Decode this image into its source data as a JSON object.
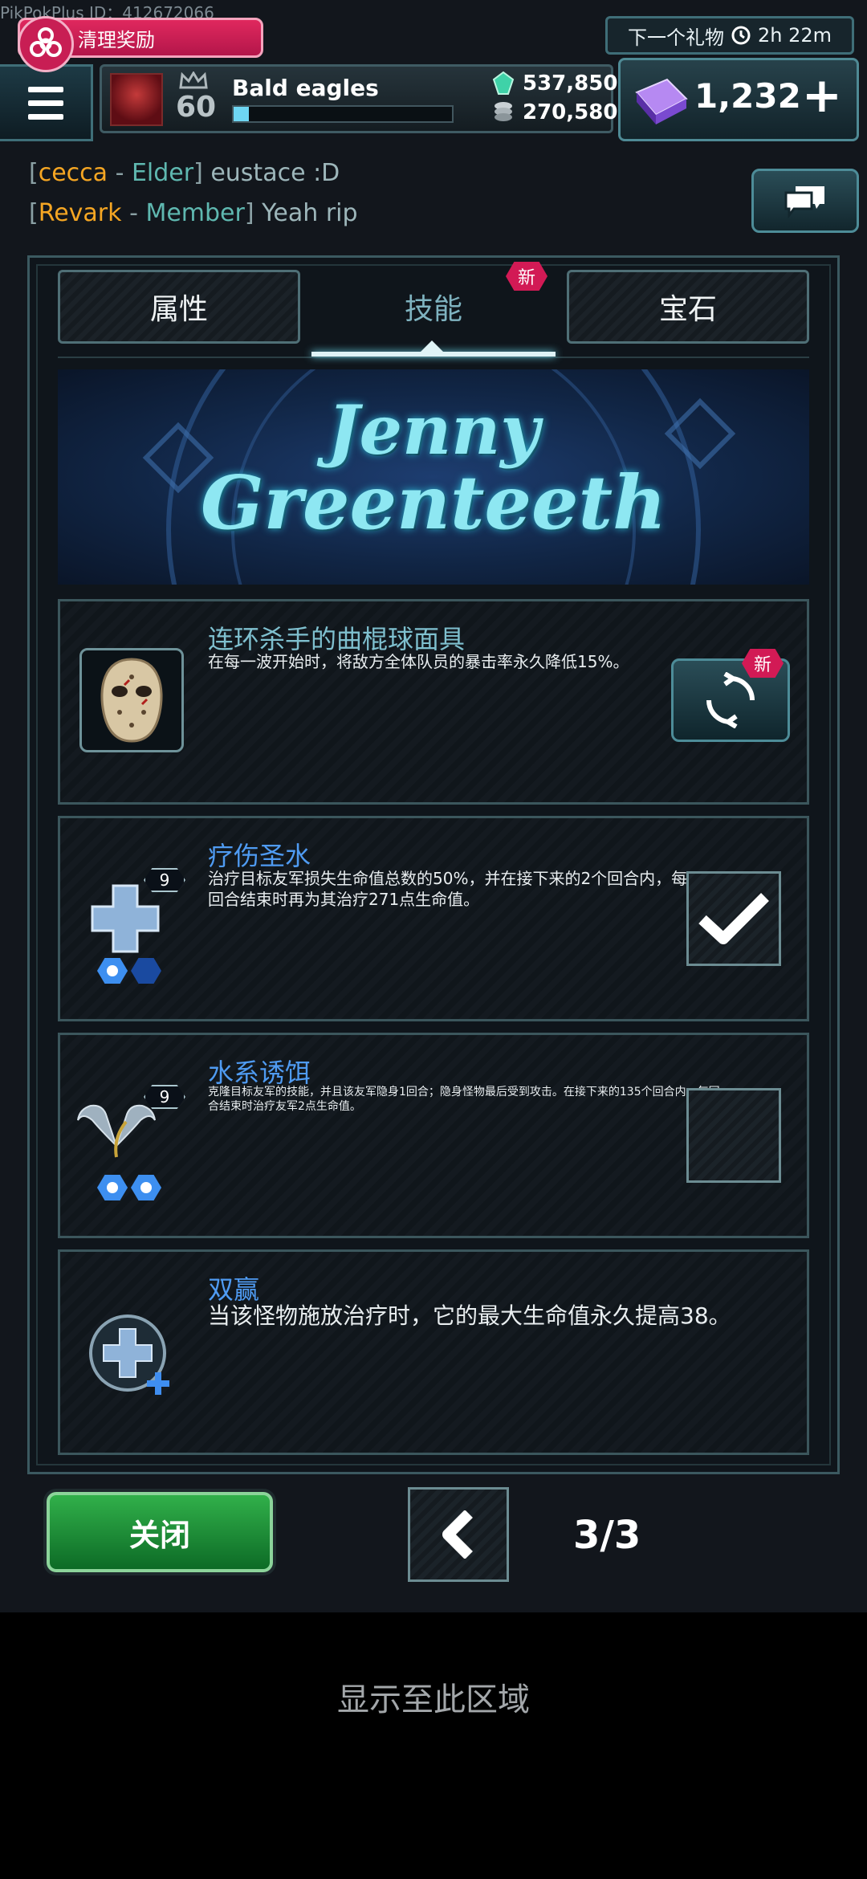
{
  "top": {
    "pid_label": "PikPokPlus ID：412672066",
    "reward_banner": "清理奖励",
    "player": {
      "level": "60",
      "name": "Bald eagles",
      "xp_progress": 0.07
    },
    "resources": {
      "gems": "537,850",
      "coins": "270,580"
    },
    "gift_timer": {
      "label": "下一个礼物",
      "time": "2h 22m"
    },
    "premium": {
      "amount": "1,232",
      "plus": "+"
    }
  },
  "chat": [
    {
      "name": "cecca",
      "role": "Elder",
      "message": "eustace  :D"
    },
    {
      "name": "Revark",
      "role": "Member",
      "message": "Yeah rip"
    }
  ],
  "tabs": {
    "attributes": "属性",
    "skills": "技能",
    "gems": "宝石",
    "new_badge": "新"
  },
  "banner": {
    "line1": "Jenny",
    "line2": "Greenteeth"
  },
  "skills": [
    {
      "title": "连环杀手的曲棍球面具",
      "description": "在每一波开始时，将敌方全体队员的暴击率永久降低15%。",
      "new_badge": "新",
      "title_color": "#7fc0cf"
    },
    {
      "title": "疗伤圣水",
      "description": "治疗目标友军损失生命值总数的50%，并在接下来的2个回合内，每回合结束时再为其治疗271点生命值。",
      "level": "9",
      "checked": true,
      "title_color": "#4f9bf2"
    },
    {
      "title": "水系诱饵",
      "description": "克隆目标友军的技能，并且该友军隐身1回合；隐身怪物最后受到攻击。在接下来的135个回合内，每回合结束时治疗友军2点生命值。",
      "level": "9",
      "checked": false,
      "title_color": "#4f9bf2"
    },
    {
      "title": "双赢",
      "description": "当该怪物施放治疗时，它的最大生命值永久提高38。",
      "title_color": "#4f9bf2"
    }
  ],
  "bottom": {
    "close_label": "关闭",
    "page_indicator": "3/3"
  },
  "footer_note": "显示至此区域",
  "colors": {
    "accent_pink": "#d21a55",
    "close_green": "#1f9a3c",
    "skill_blue": "#4f9bf2",
    "chat_name": "#f5a623"
  },
  "icons": [
    "biohazard-icon",
    "menu-icon",
    "crown-icon",
    "gem-icon",
    "coin-stack-icon",
    "clock-icon",
    "premium-bar-icon",
    "chat-icon",
    "refresh-icon",
    "checkmark-icon",
    "chevron-left-icon"
  ]
}
